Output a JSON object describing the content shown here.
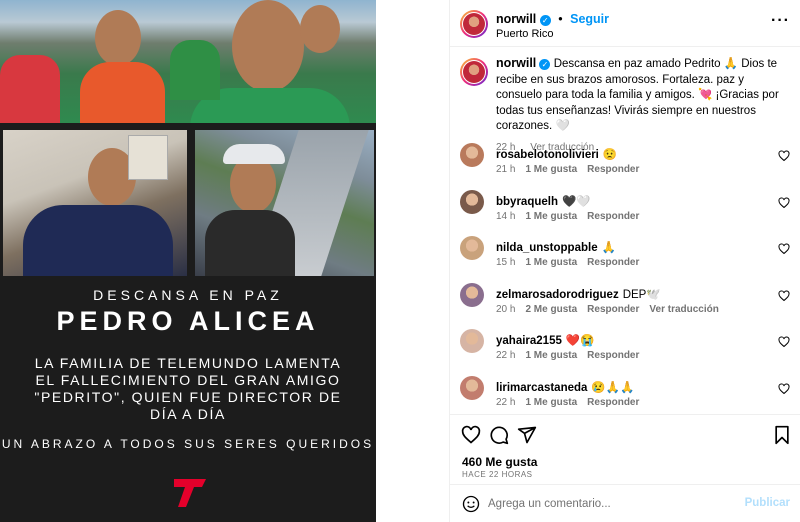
{
  "post_image": {
    "subtitle": "DESCANSA EN PAZ",
    "name": "PEDRO ALICEA",
    "body": "LA FAMILIA DE TELEMUNDO LAMENTA EL FALLECIMIENTO DEL GRAN AMIGO \"PEDRITO\", QUIEN FUE DIRECTOR DE DÍA A DÍA",
    "hug": "UN ABRAZO A TODOS SUS SERES QUERIDOS",
    "logo_color": "#e4002b"
  },
  "header": {
    "username": "norwill",
    "separator": "•",
    "follow_label": "Seguir",
    "location": "Puerto Rico",
    "more_icon": "more-horizontal-icon"
  },
  "caption": {
    "username": "norwill",
    "text": "Descansa en paz amado Pedrito 🙏 Dios te recibe en sus brazos amorosos. Fortaleza. paz y consuelo para toda la familia y amigos. 💘 ¡Gracias por todas tus enseñanzas! Vivirás siempre en nuestros corazones. 🤍",
    "time": "22 h",
    "translate": "Ver traducción"
  },
  "comments": [
    {
      "username": "rosabelotonolivieri",
      "text": "😟",
      "time": "21 h",
      "likes": "1 Me gusta",
      "reply": "Responder",
      "translate": ""
    },
    {
      "username": "bbyraquelh",
      "text": "🖤🤍",
      "time": "14 h",
      "likes": "1 Me gusta",
      "reply": "Responder",
      "translate": ""
    },
    {
      "username": "nilda_unstoppable",
      "text": "🙏",
      "time": "15 h",
      "likes": "1 Me gusta",
      "reply": "Responder",
      "translate": ""
    },
    {
      "username": "zelmarosadorodriguez",
      "text": "DEP🕊️",
      "time": "20 h",
      "likes": "2 Me gusta",
      "reply": "Responder",
      "translate": "Ver traducción"
    },
    {
      "username": "yahaira2155",
      "text": "❤️😭",
      "time": "22 h",
      "likes": "1 Me gusta",
      "reply": "Responder",
      "translate": ""
    },
    {
      "username": "lirimarcastaneda",
      "text": "😢🙏🙏",
      "time": "22 h",
      "likes": "1 Me gusta",
      "reply": "Responder",
      "translate": ""
    }
  ],
  "actions": {
    "likes": "460 Me gusta",
    "ago": "HACE 22 HORAS"
  },
  "composer": {
    "placeholder": "Agrega un comentario...",
    "publish": "Publicar"
  },
  "colors": {
    "link_blue": "#0095f6",
    "muted": "#737373",
    "publish_disabled": "#b2dffc"
  }
}
